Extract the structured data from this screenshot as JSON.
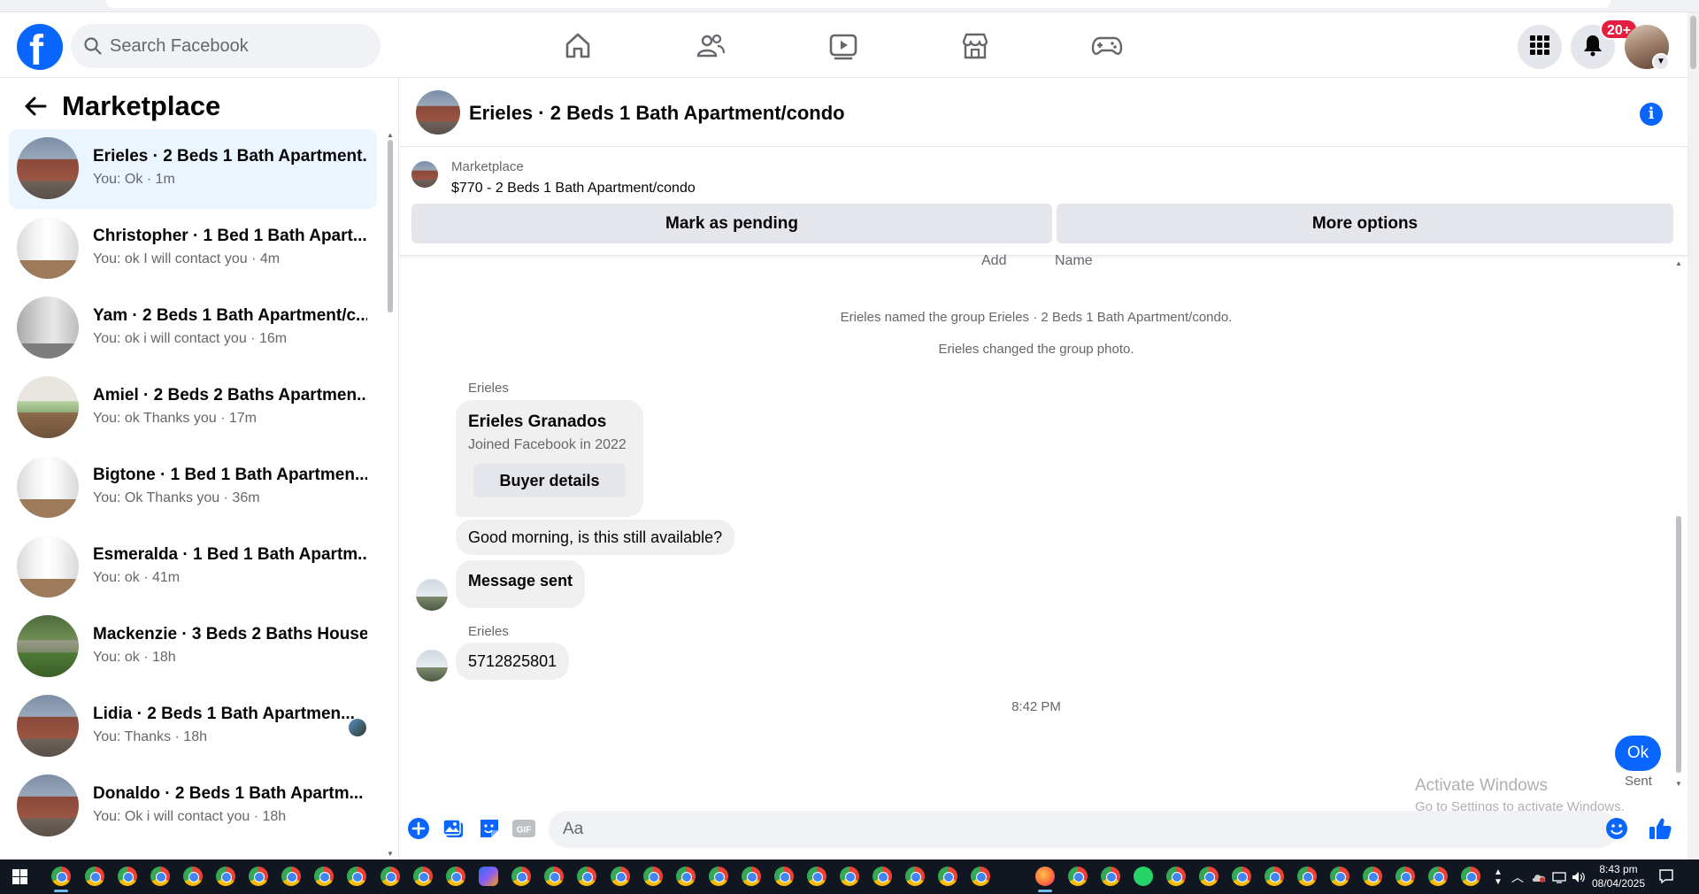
{
  "search": {
    "placeholder": "Search Facebook"
  },
  "nav": {
    "items": [
      "home-icon",
      "friends-icon",
      "watch-icon",
      "marketplace-icon",
      "gaming-icon"
    ],
    "notifications_badge": "20+"
  },
  "sidebar": {
    "title": "Marketplace",
    "conversations": [
      {
        "title": "Erieles · 2 Beds 1 Bath Apartment...",
        "preview": "You: Ok · 1m",
        "thumb": "brick",
        "active": true
      },
      {
        "title": "Christopher · 1 Bed 1 Bath Apart...",
        "preview": "You: ok I will contact you · 4m",
        "thumb": "white"
      },
      {
        "title": "Yam · 2 Beds 1 Bath Apartment/c...",
        "preview": "You: ok i will contact you · 16m",
        "thumb": "gray"
      },
      {
        "title": "Amiel · 2 Beds 2 Baths Apartmen...",
        "preview": "You: ok Thanks you · 17m",
        "thumb": "room"
      },
      {
        "title": "Bigtone · 1 Bed 1 Bath Apartmen...",
        "preview": "You: Ok Thanks you · 36m",
        "thumb": "white"
      },
      {
        "title": "Esmeralda · 1 Bed 1 Bath Apartm...",
        "preview": "You: ok · 41m",
        "thumb": "white"
      },
      {
        "title": "Mackenzie · 3 Beds 2 Baths House",
        "preview": "You: ok · 18h",
        "thumb": "house"
      },
      {
        "title": "Lidia · 2 Beds 1 Bath Apartmen...",
        "preview": "You: Thanks · 18h",
        "thumb": "brick",
        "seen_avatar": true
      },
      {
        "title": "Donaldo · 2 Beds 1 Bath Apartm...",
        "preview": "You: Ok i will contact you · 18h",
        "thumb": "brick"
      }
    ]
  },
  "chat": {
    "title": "Erieles · 2 Beds 1 Bath Apartment/condo",
    "listing": {
      "source": "Marketplace",
      "description": "$770 - 2 Beds 1 Bath Apartment/condo",
      "pending_button": "Mark as pending",
      "more_button": "More options"
    },
    "partial_top": [
      "Add",
      "Name"
    ],
    "system_messages": [
      "Erieles named the group Erieles · 2 Beds 1 Bath Apartment/condo.",
      "Erieles changed the group photo."
    ],
    "sender_name": "Erieles",
    "profile_card": {
      "name": "Erieles Granados",
      "meta": "Joined Facebook in 2022",
      "button": "Buyer details"
    },
    "messages": [
      {
        "text": "Good morning, is this still available?"
      },
      {
        "text": "Message sent"
      },
      {
        "text": "5712825801"
      }
    ],
    "timestamp": "8:42 PM",
    "outgoing": {
      "text": "Ok",
      "status": "Sent"
    },
    "composer_placeholder": "Aa",
    "composer_tools": [
      "plus-icon",
      "photo-icon",
      "sticker-icon",
      "gif-icon"
    ],
    "gif_label": "GIF"
  },
  "watermark": {
    "line1": "Activate Windows",
    "line2": "Go to Settings to activate Windows."
  },
  "taskbar": {
    "time": "8:43 pm",
    "date": "08/04/2025"
  },
  "colors": {
    "brand": "#0866ff",
    "active_conversation": "#ebf5ff",
    "badge": "#e41e3f",
    "taskbar": "#111720"
  }
}
